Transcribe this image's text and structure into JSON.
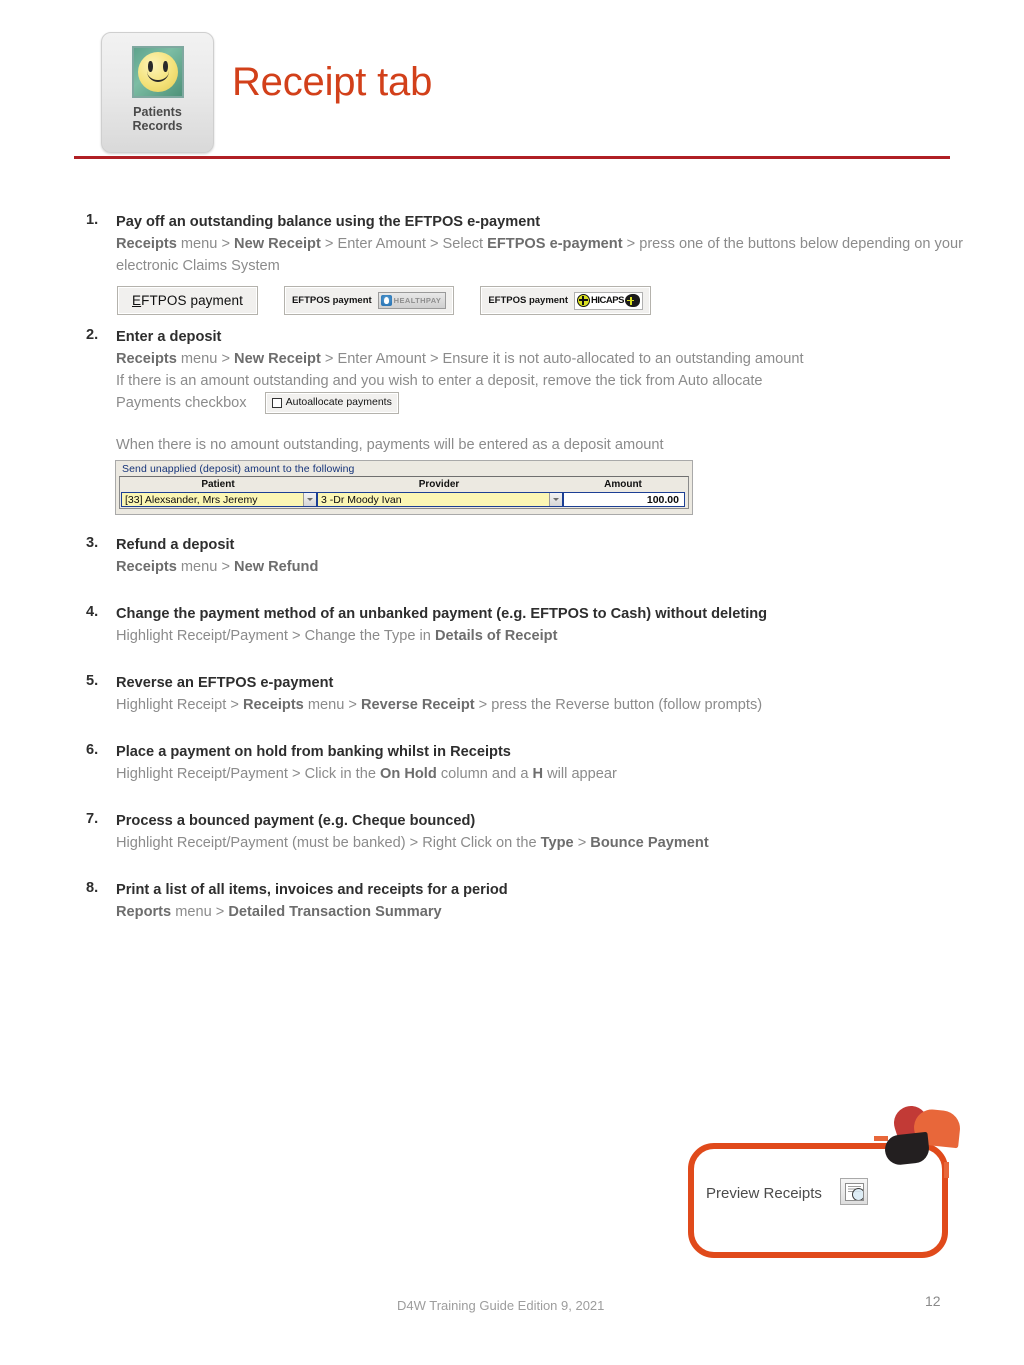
{
  "header": {
    "app_icon": {
      "label_line1": "Patients",
      "label_line2": "Records",
      "icon": "smiley-face-icon"
    },
    "title": "Receipt tab",
    "title_color": "#d2401a",
    "rule_color": "#b01f24"
  },
  "items": [
    {
      "number": "1.",
      "heading": "Pay off an outstanding balance using the EFTPOS e-payment",
      "sub_parts": [
        {
          "text": "Receipts",
          "bold": true
        },
        {
          "text": " menu > ",
          "bold": false
        },
        {
          "text": "New Receipt",
          "bold": true
        },
        {
          "text": " > Enter Amount > Select ",
          "bold": false
        },
        {
          "text": "EFTPOS e-payment",
          "bold": true
        },
        {
          "text": " > press one of the buttons below depending on your electronic Claims System",
          "bold": false
        }
      ],
      "widgets": {
        "eftpos_plain": {
          "label_accel": "E",
          "label_rest": "FTPOS payment"
        },
        "eftpos_healthpay": {
          "label": "EFTPOS payment",
          "brand": "HEALTHPAY"
        },
        "eftpos_hicaps": {
          "label": "EFTPOS payment",
          "brand": "HICAPS"
        }
      }
    },
    {
      "number": "2.",
      "heading": "Enter a deposit",
      "sub_parts": [
        {
          "text": "Receipts",
          "bold": true
        },
        {
          "text": " menu > ",
          "bold": false
        },
        {
          "text": "New Receipt",
          "bold": true
        },
        {
          "text": " > Enter Amount > Ensure it is not auto-allocated to an outstanding amount",
          "bold": false
        }
      ],
      "line2": "If there is an amount outstanding and you wish to enter a deposit, remove the tick from Auto allocate",
      "line3": "Payments checkbox",
      "checkbox_widget": {
        "label": "Autoallocate payments",
        "checked": false
      },
      "line4": "When there is no amount outstanding, payments will be entered as a deposit amount"
    },
    {
      "number": "3.",
      "heading": "Refund a deposit",
      "sub_parts": [
        {
          "text": "Receipts",
          "bold": true
        },
        {
          "text": " menu > ",
          "bold": false
        },
        {
          "text": "New Refund",
          "bold": true
        }
      ]
    },
    {
      "number": "4.",
      "heading": "Change the payment method of an unbanked payment (e.g. EFTPOS to Cash) without deleting",
      "sub_parts": [
        {
          "text": "Highlight Receipt/Payment > Change the Type in ",
          "bold": false
        },
        {
          "text": "Details of Receipt",
          "bold": true
        }
      ]
    },
    {
      "number": "5.",
      "heading": "Reverse an EFTPOS e-payment",
      "sub_parts": [
        {
          "text": "Highlight Receipt > ",
          "bold": false
        },
        {
          "text": "Receipts",
          "bold": true
        },
        {
          "text": " menu > ",
          "bold": false
        },
        {
          "text": "Reverse Receipt",
          "bold": true
        },
        {
          "text": " > press the Reverse button (follow prompts)",
          "bold": false
        }
      ]
    },
    {
      "number": "6.",
      "heading": "Place a payment on hold from banking whilst in Receipts",
      "sub_parts": [
        {
          "text": "Highlight Receipt/Payment > Click in the ",
          "bold": false
        },
        {
          "text": "On Hold",
          "bold": true
        },
        {
          "text": " column and a ",
          "bold": false
        },
        {
          "text": "H",
          "bold": true
        },
        {
          "text": " will appear",
          "bold": false
        }
      ]
    },
    {
      "number": "7.",
      "heading": "Process a bounced payment (e.g. Cheque bounced)",
      "sub_parts": [
        {
          "text": "Highlight Receipt/Payment (must be banked) > Right Click on the ",
          "bold": false
        },
        {
          "text": "Type",
          "bold": true
        },
        {
          "text": " > ",
          "bold": false
        },
        {
          "text": "Bounce Payment",
          "bold": true
        }
      ]
    },
    {
      "number": "8.",
      "heading": "Print a list of all items, invoices and receipts for a period",
      "sub_parts": [
        {
          "text": "Reports",
          "bold": true
        },
        {
          "text": " menu > ",
          "bold": false
        },
        {
          "text": "Detailed Transaction Summary",
          "bold": true
        }
      ]
    }
  ],
  "deposit_grid": {
    "caption": "Send unapplied (deposit) amount to the following",
    "columns": [
      "Patient",
      "Provider",
      "Amount"
    ],
    "row": {
      "patient": "[33] Alexsander, Mrs Jeremy",
      "provider": "3 -Dr Moody Ivan",
      "amount": "100.00"
    }
  },
  "callout": {
    "label": "Preview Receipts",
    "icon": "preview-magnifier-icon",
    "border_color": "#e04a1b"
  },
  "footer": {
    "text": "D4W Training Guide Edition 9, 2021",
    "page_number": "12"
  }
}
